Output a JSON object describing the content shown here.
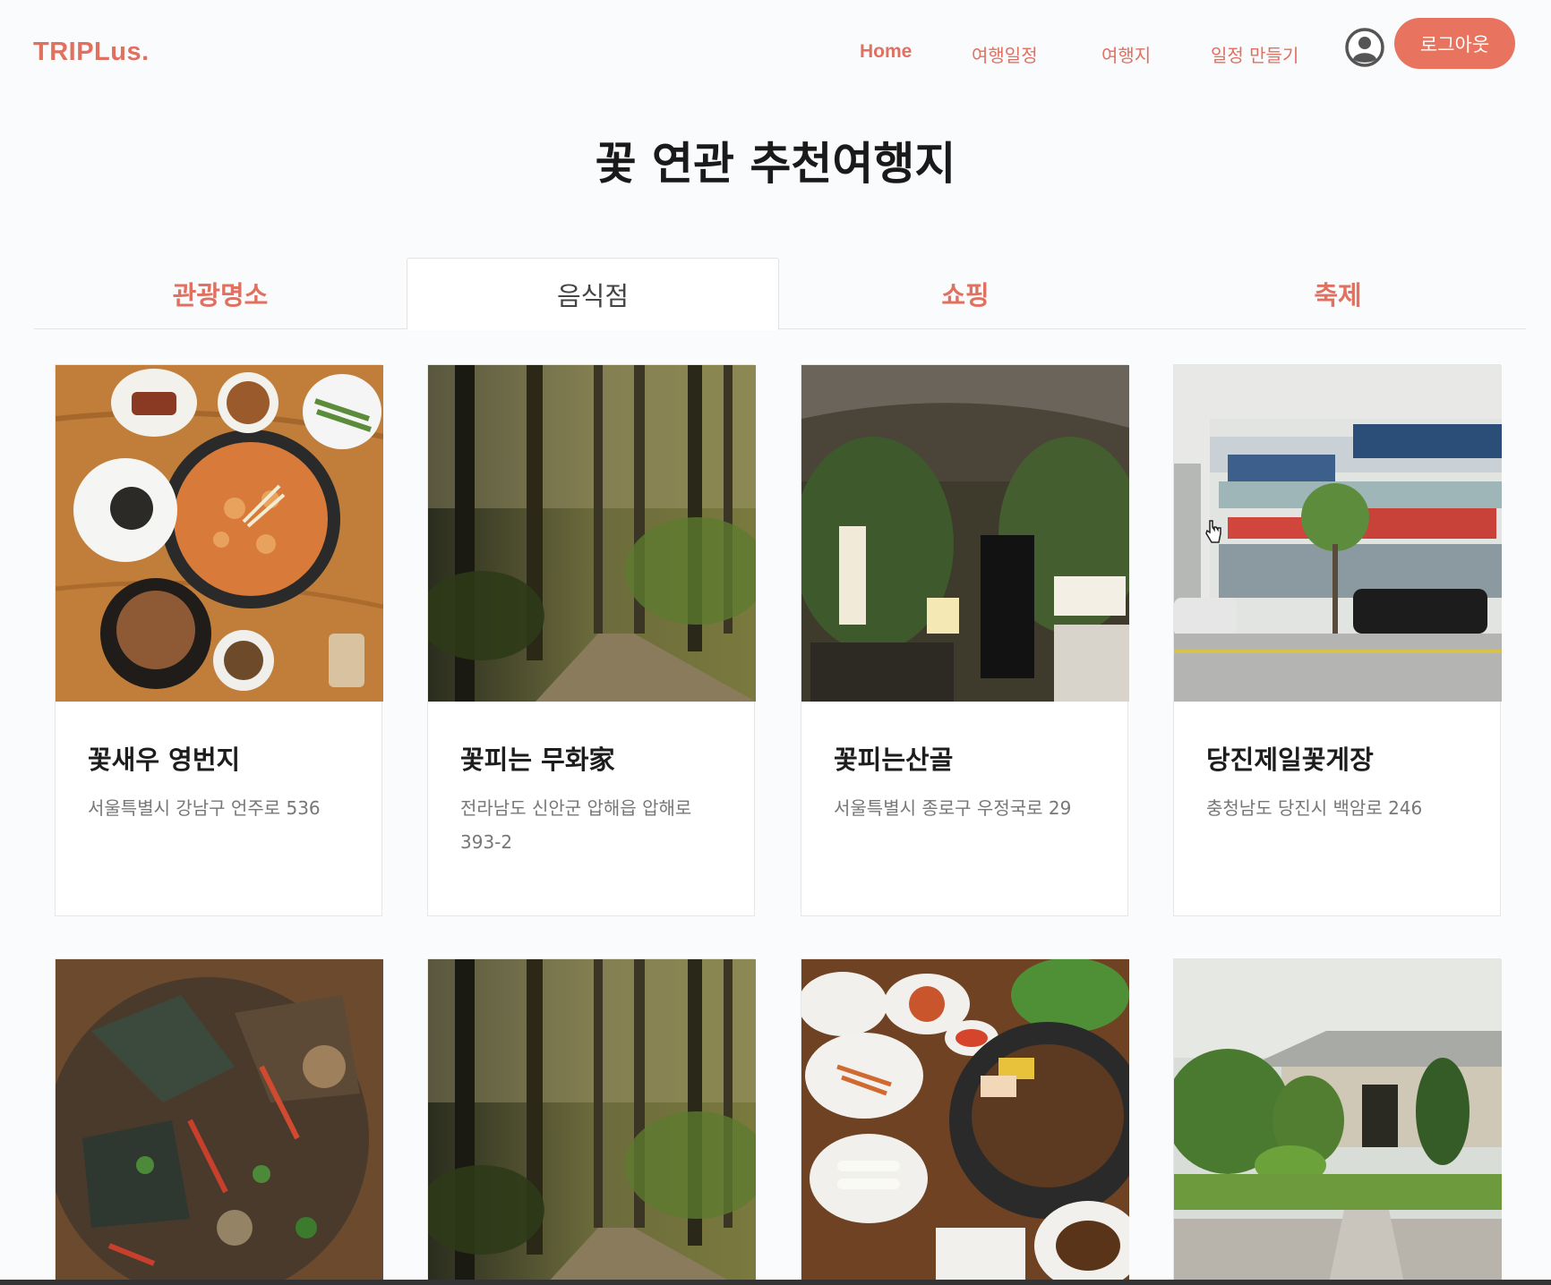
{
  "navbar": {
    "logo": "TRIPLus.",
    "links": [
      "Home",
      "여행일정",
      "여행지",
      "일정 만들기"
    ],
    "logout": "로그아웃"
  },
  "page_title": "꽃 연관 추천여행지",
  "tabs": [
    {
      "label": "관광명소",
      "active": false
    },
    {
      "label": "음식점",
      "active": true
    },
    {
      "label": "쇼핑",
      "active": false
    },
    {
      "label": "축제",
      "active": false
    }
  ],
  "cards": [
    {
      "title": "꽃새우 영번지",
      "address": "서울특별시 강남구 언주로 536",
      "image": "food-hotpot"
    },
    {
      "title": "꽃피는 무화家",
      "address": "전라남도 신안군 압해읍 압해로 393-2",
      "image": "forest"
    },
    {
      "title": "꽃피는산골",
      "address": "서울특별시 종로구 우정국로 29",
      "image": "restaurant-entrance"
    },
    {
      "title": "당진제일꽃게장",
      "address": "충청남도 당진시 백암로 246",
      "image": "building-street"
    },
    {
      "title": "",
      "address": "",
      "image": "crab-dish"
    },
    {
      "title": "",
      "address": "",
      "image": "forest"
    },
    {
      "title": "",
      "address": "",
      "image": "korean-bbq"
    },
    {
      "title": "",
      "address": "",
      "image": "traditional-house"
    }
  ],
  "colors": {
    "accent": "#e07060",
    "button": "#e8735f"
  }
}
